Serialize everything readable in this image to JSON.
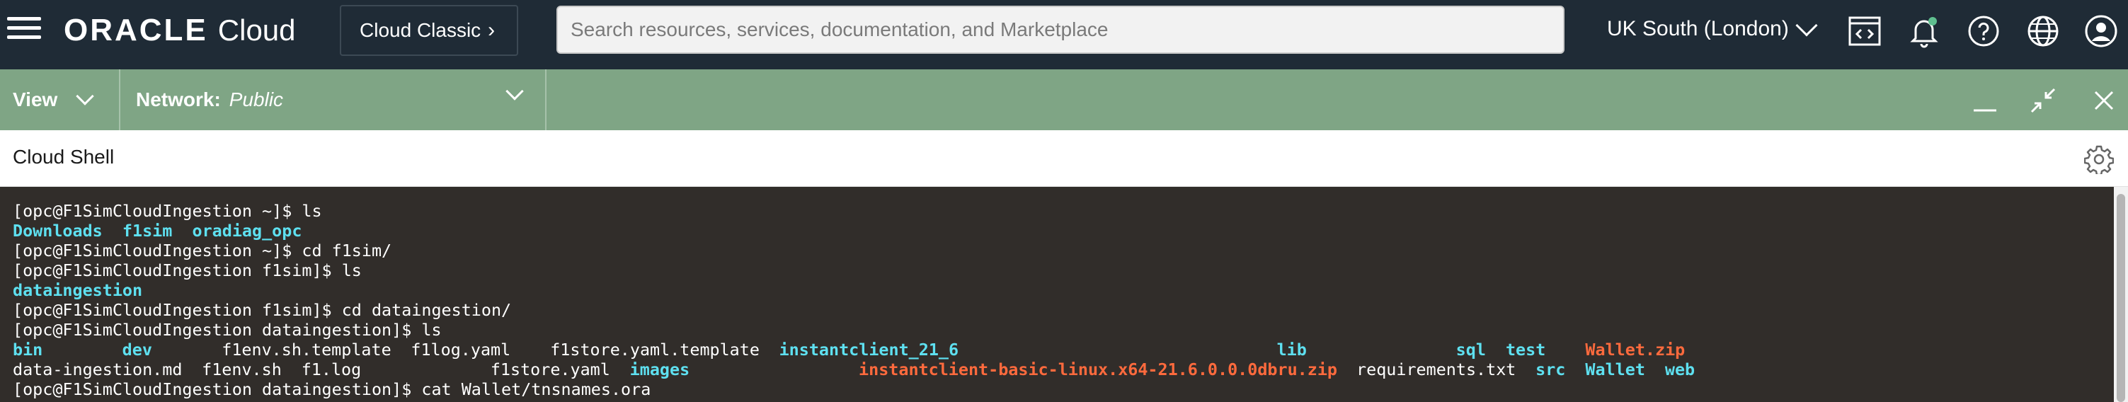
{
  "header": {
    "brand_oracle": "ORACLE",
    "brand_cloud": "Cloud",
    "classic_label": "Cloud Classic",
    "search_placeholder": "Search resources, services, documentation, and Marketplace",
    "region_label": "UK South (London)"
  },
  "shell_bar": {
    "view_label": "View",
    "network_label": "Network:",
    "network_value": "Public"
  },
  "panel": {
    "title": "Cloud Shell"
  },
  "terminal": {
    "colors": {
      "directory": "#5ee0f0",
      "archive": "#ff6a3d",
      "text": "#ffffff",
      "background": "#312d2a"
    },
    "lines": [
      {
        "kind": "cmd",
        "text": "[opc@F1SimCloudIngestion ~]$ ls"
      },
      {
        "kind": "dirs",
        "items": [
          "Downloads",
          "f1sim",
          "oradiag_opc"
        ]
      },
      {
        "kind": "cmd",
        "text": "[opc@F1SimCloudIngestion ~]$ cd f1sim/"
      },
      {
        "kind": "cmd",
        "text": "[opc@F1SimCloudIngestion f1sim]$ ls"
      },
      {
        "kind": "dirs",
        "items": [
          "dataingestion"
        ]
      },
      {
        "kind": "cmd",
        "text": "[opc@F1SimCloudIngestion f1sim]$ cd dataingestion/"
      },
      {
        "kind": "cmd",
        "text": "[opc@F1SimCloudIngestion dataingestion]$ ls"
      },
      {
        "kind": "ls",
        "items": [
          {
            "t": "bin",
            "c": "dir",
            "w": 11
          },
          {
            "t": "dev",
            "c": "dir",
            "w": 10
          },
          {
            "t": "f1env.sh.template",
            "c": "file",
            "w": 19
          },
          {
            "t": "f1log.yaml",
            "c": "file",
            "w": 14
          },
          {
            "t": "f1store.yaml.template",
            "c": "file",
            "w": 23
          },
          {
            "t": "instantclient_21_6",
            "c": "dir",
            "w": 50
          },
          {
            "t": "lib",
            "c": "dir",
            "w": 18
          },
          {
            "t": "sql",
            "c": "dir",
            "w": 5
          },
          {
            "t": "test",
            "c": "dir",
            "w": 8
          },
          {
            "t": "Wallet.zip",
            "c": "arc",
            "w": 10
          }
        ]
      },
      {
        "kind": "ls",
        "items": [
          {
            "t": "data-ingestion.md",
            "c": "file",
            "w": 19
          },
          {
            "t": "f1env.sh",
            "c": "file",
            "w": 10
          },
          {
            "t": "f1.log",
            "c": "file",
            "w": 19
          },
          {
            "t": "f1store.yaml",
            "c": "file",
            "w": 14
          },
          {
            "t": "images",
            "c": "dir",
            "w": 23
          },
          {
            "t": "instantclient-basic-linux.x64-21.6.0.0.0dbru.zip",
            "c": "arc",
            "w": 50
          },
          {
            "t": "requirements.txt",
            "c": "file",
            "w": 18
          },
          {
            "t": "src",
            "c": "dir",
            "w": 5
          },
          {
            "t": "Wallet",
            "c": "dir",
            "w": 8
          },
          {
            "t": "web",
            "c": "dir",
            "w": 10
          }
        ]
      },
      {
        "kind": "cmd",
        "text": "[opc@F1SimCloudIngestion dataingestion]$ cat Wallet/tnsnames.ora"
      }
    ]
  }
}
